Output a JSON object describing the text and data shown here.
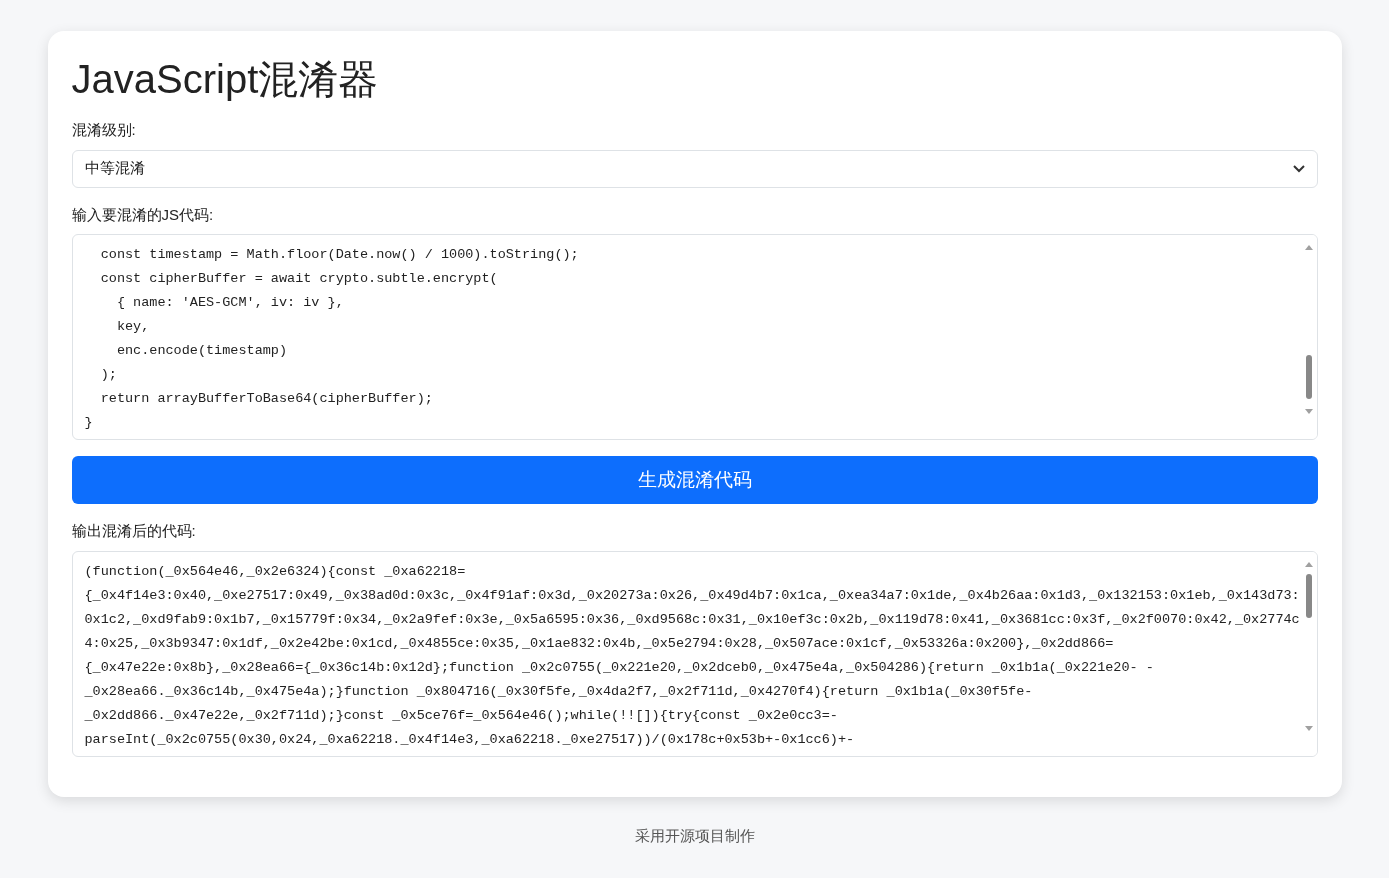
{
  "title": "JavaScript混淆器",
  "level_field": {
    "label": "混淆级别:",
    "value": "中等混淆"
  },
  "input": {
    "label": "输入要混淆的JS代码:",
    "lines": [
      "  const timestamp = Math.floor(Date.now() / 1000).toString();",
      "  const cipherBuffer = await crypto.subtle.encrypt(",
      "    { name: 'AES-GCM', iv: iv },",
      "    key,",
      "    enc.encode(timestamp)",
      "  );",
      "  return arrayBufferToBase64(cipherBuffer);",
      "}"
    ]
  },
  "generate_button": "生成混淆代码",
  "output": {
    "label": "输出混淆后的代码:",
    "lines": [
      "(function(_0x564e46,_0x2e6324){const _0xa62218=",
      "{_0x4f14e3:0x40,_0xe27517:0x49,_0x38ad0d:0x3c,_0x4f91af:0x3d,_0x20273a:0x26,_0x49d4b7:0x1ca,_0xea34a7:0x1de,_0x4b26aa:0x1d3,_0x132153:0x1eb,_0x143d73:",
      "0x1c2,_0xd9fab9:0x1b7,_0x15779f:0x34,_0x2a9fef:0x3e,_0x5a6595:0x36,_0xd9568c:0x31,_0x10ef3c:0x2b,_0x119d78:0x41,_0x3681cc:0x3f,_0x2f0070:0x42,_0x2774c",
      "4:0x25,_0x3b9347:0x1df,_0x2e42be:0x1cd,_0x4855ce:0x35,_0x1ae832:0x4b,_0x5e2794:0x28,_0x507ace:0x1cf,_0x53326a:0x200},_0x2dd866=",
      "{_0x47e22e:0x8b},_0x28ea66={_0x36c14b:0x12d};function _0x2c0755(_0x221e20,_0x2dceb0,_0x475e4a,_0x504286){return _0x1b1a(_0x221e20- -",
      "_0x28ea66._0x36c14b,_0x475e4a);}function _0x804716(_0x30f5fe,_0x4da2f7,_0x2f711d,_0x4270f4){return _0x1b1a(_0x30f5fe-",
      "_0x2dd866._0x47e22e,_0x2f711d);}const _0x5ce76f=_0x564e46();while(!![]){try{const _0x2e0cc3=-",
      "parseInt(_0x2c0755(0x30,0x24,_0xa62218._0x4f14e3,_0xa62218._0xe27517))/(0x178c+0x53b+-0x1cc6)+-"
    ]
  },
  "footer": "采用开源项目制作"
}
